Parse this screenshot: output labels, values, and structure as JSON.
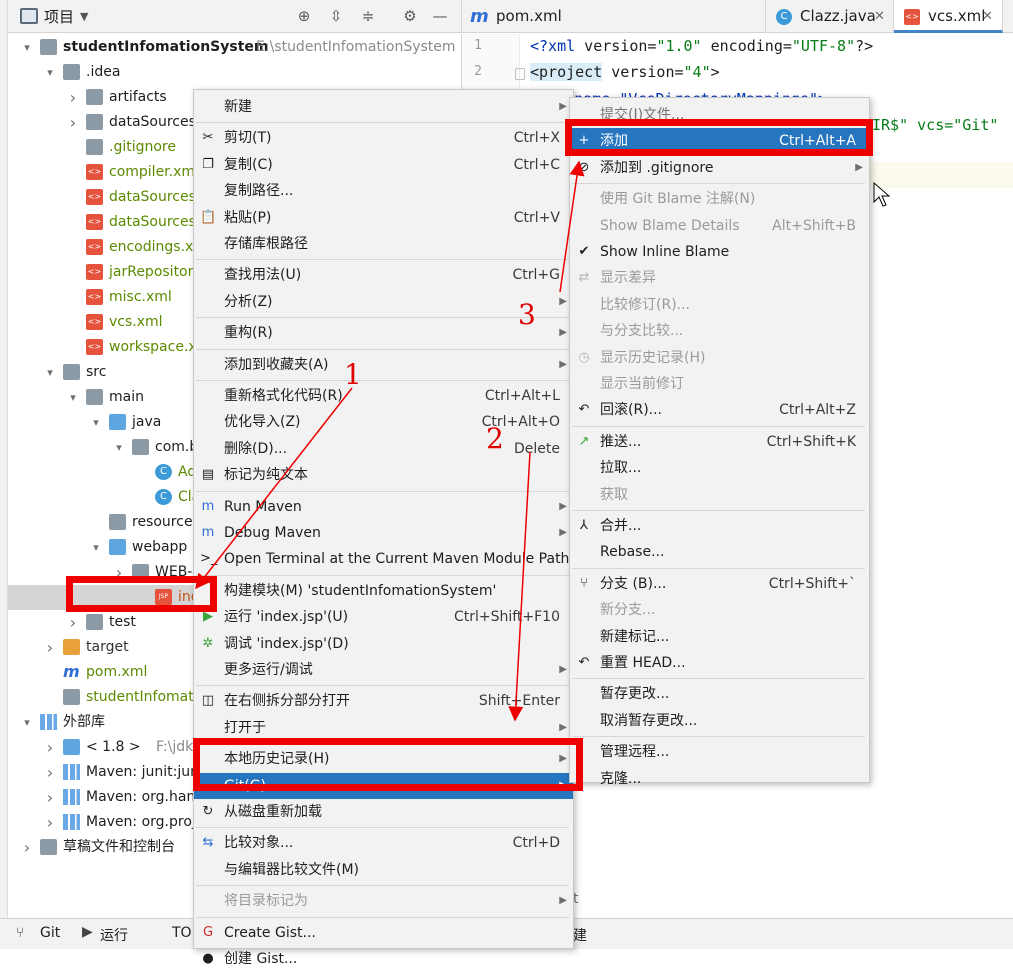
{
  "project_panel": {
    "title": "项目",
    "tree": [
      {
        "depth": 0,
        "name": "studentInfomationSystem",
        "path": "E:\\studentInfomationSystem",
        "icon": "module-icon",
        "expanded": true
      },
      {
        "depth": 1,
        "name": ".idea",
        "icon": "folder-icon",
        "expanded": true
      },
      {
        "depth": 2,
        "name": "artifacts",
        "icon": "folder-icon",
        "expanded": false
      },
      {
        "depth": 2,
        "name": "dataSources",
        "icon": "folder-icon",
        "expanded": false
      },
      {
        "depth": 2,
        "name": ".gitignore",
        "icon": "gitignore-icon",
        "color": "#5b8a00"
      },
      {
        "depth": 2,
        "name": "compiler.xml",
        "icon": "xml-icon",
        "color": "#5b8a00"
      },
      {
        "depth": 2,
        "name": "dataSources.xml",
        "icon": "xml-icon",
        "color": "#5b8a00"
      },
      {
        "depth": 2,
        "name": "dataSources.local.xml",
        "icon": "xml-icon",
        "color": "#5b8a00"
      },
      {
        "depth": 2,
        "name": "encodings.xml",
        "icon": "xml-icon",
        "color": "#5b8a00"
      },
      {
        "depth": 2,
        "name": "jarRepositories.xml",
        "icon": "xml-icon",
        "color": "#5b8a00"
      },
      {
        "depth": 2,
        "name": "misc.xml",
        "icon": "xml-icon",
        "color": "#5b8a00"
      },
      {
        "depth": 2,
        "name": "vcs.xml",
        "icon": "xml-icon",
        "color": "#5b8a00"
      },
      {
        "depth": 2,
        "name": "workspace.xml",
        "icon": "xml-icon",
        "color": "#5b8a00"
      },
      {
        "depth": 1,
        "name": "src",
        "icon": "folder-icon",
        "expanded": true
      },
      {
        "depth": 2,
        "name": "main",
        "icon": "folder-icon",
        "expanded": true
      },
      {
        "depth": 3,
        "name": "java",
        "icon": "source-folder-icon",
        "expanded": true
      },
      {
        "depth": 4,
        "name": "com.b",
        "icon": "package-icon",
        "expanded": true
      },
      {
        "depth": 5,
        "name": "Ad",
        "icon": "class-icon",
        "color": "#5b8a00"
      },
      {
        "depth": 5,
        "name": "Cla",
        "icon": "class-icon",
        "color": "#5b8a00"
      },
      {
        "depth": 3,
        "name": "resources",
        "icon": "resources-folder-icon"
      },
      {
        "depth": 3,
        "name": "webapp",
        "icon": "web-folder-icon",
        "expanded": true
      },
      {
        "depth": 4,
        "name": "WEB-I",
        "icon": "folder-icon",
        "expanded": false
      },
      {
        "depth": 5,
        "name": "index.",
        "icon": "jsp-icon",
        "color": "#c8541a",
        "selected": true
      },
      {
        "depth": 2,
        "name": "test",
        "icon": "folder-icon",
        "expanded": false
      },
      {
        "depth": 1,
        "name": "target",
        "icon": "excluded-folder-icon",
        "expanded": false,
        "color": "#333333"
      },
      {
        "depth": 1,
        "name": "pom.xml",
        "icon": "maven-icon",
        "color": "#5b8a00"
      },
      {
        "depth": 1,
        "name": "studentInfomatio",
        "icon": "iml-icon",
        "color": "#5b8a00"
      },
      {
        "depth": 0,
        "name": "外部库",
        "icon": "library-icon",
        "expanded": true
      },
      {
        "depth": 1,
        "name": "< 1.8 >",
        "path": "F:\\jdk8",
        "icon": "jdk-icon",
        "expanded": false
      },
      {
        "depth": 1,
        "name": "Maven: junit:juni",
        "icon": "library-icon",
        "expanded": false
      },
      {
        "depth": 1,
        "name": "Maven: org.ham",
        "icon": "library-icon",
        "expanded": false
      },
      {
        "depth": 1,
        "name": "Maven: org.proje",
        "icon": "library-icon",
        "expanded": false
      },
      {
        "depth": 0,
        "name": "草稿文件和控制台",
        "icon": "scratch-icon",
        "expanded": false
      }
    ]
  },
  "editor_tabs": [
    {
      "label": "pom.xml (studentInfomationSystem)",
      "icon": "maven-icon",
      "active": false
    },
    {
      "label": "Clazz.java",
      "icon": "class-icon",
      "active": false
    },
    {
      "label": "vcs.xml",
      "icon": "xml-icon",
      "active": true
    }
  ],
  "editor": {
    "line_numbers": [
      "1",
      "2"
    ],
    "lines": [
      "<?xml version=\"1.0\" encoding=\"UTF-8\"?>",
      "<project version=\"4\">",
      "  <component name=\"VcsDirectoryMappings\">",
      "    <mapping directory=\"$PROJECT_DIR$\" vcs=\"Git\" />"
    ],
    "visible_fragments": {
      "l3": "mponent name=\"VcsDirectoryMappings\">",
      "l4": "IR$\" vcs=\"Git\""
    }
  },
  "context_menu": [
    {
      "label": "新建",
      "submenu": true
    },
    {
      "sep": true
    },
    {
      "label": "剪切(T)",
      "shortcut": "Ctrl+X",
      "icon": "cut-icon"
    },
    {
      "label": "复制(C)",
      "shortcut": "Ctrl+C",
      "icon": "copy-icon"
    },
    {
      "label": "复制路径..."
    },
    {
      "label": "粘贴(P)",
      "shortcut": "Ctrl+V",
      "icon": "paste-icon"
    },
    {
      "label": "存储库根路径"
    },
    {
      "sep": true
    },
    {
      "label": "查找用法(U)",
      "shortcut": "Ctrl+G"
    },
    {
      "label": "分析(Z)",
      "submenu": true
    },
    {
      "sep": true
    },
    {
      "label": "重构(R)",
      "submenu": true
    },
    {
      "sep": true
    },
    {
      "label": "添加到收藏夹(A)",
      "submenu": true
    },
    {
      "sep": true
    },
    {
      "label": "重新格式化代码(R)",
      "shortcut": "Ctrl+Alt+L"
    },
    {
      "label": "优化导入(Z)",
      "shortcut": "Ctrl+Alt+O"
    },
    {
      "label": "删除(D)...",
      "shortcut": "Delete"
    },
    {
      "label": "标记为纯文本",
      "icon": "plain-text-icon"
    },
    {
      "sep": true
    },
    {
      "label": "Run Maven",
      "submenu": true,
      "icon": "maven-run-icon"
    },
    {
      "label": "Debug Maven",
      "submenu": true,
      "icon": "maven-debug-icon"
    },
    {
      "label": "Open Terminal at the Current Maven Module Path",
      "icon": "terminal-icon"
    },
    {
      "sep": true
    },
    {
      "label": "构建模块(M) 'studentInfomationSystem'"
    },
    {
      "label": "运行 'index.jsp'(U)",
      "shortcut": "Ctrl+Shift+F10",
      "icon": "run-icon"
    },
    {
      "label": "调试 'index.jsp'(D)",
      "icon": "debug-icon"
    },
    {
      "label": "更多运行/调试",
      "submenu": true
    },
    {
      "sep": true
    },
    {
      "label": "在右侧拆分部分打开",
      "shortcut": "Shift+Enter",
      "icon": "split-icon"
    },
    {
      "label": "打开于",
      "submenu": true
    },
    {
      "sep": true
    },
    {
      "label": "本地历史记录(H)",
      "submenu": true
    },
    {
      "label": "Git(G)",
      "submenu": true,
      "highlighted": true
    },
    {
      "label": "从磁盘重新加载",
      "icon": "reload-icon"
    },
    {
      "sep": true
    },
    {
      "label": "比较对象...",
      "shortcut": "Ctrl+D",
      "icon": "compare-icon"
    },
    {
      "label": "与编辑器比较文件(M)"
    },
    {
      "sep": true
    },
    {
      "label": "将目录标记为",
      "submenu": true,
      "disabled": true
    },
    {
      "sep": true
    },
    {
      "label": "Create Gist...",
      "icon": "gist-icon"
    },
    {
      "label": "创建 Gist...",
      "icon": "github-icon"
    }
  ],
  "git_submenu": [
    {
      "label": "提交(I)文件...",
      "partial": true
    },
    {
      "label": "添加",
      "shortcut": "Ctrl+Alt+A",
      "highlighted": true,
      "icon": "plus-icon"
    },
    {
      "label": "添加到 .gitignore",
      "submenu": true,
      "icon": "gitignore-icon"
    },
    {
      "sep": true
    },
    {
      "label": "使用 Git Blame 注解(N)",
      "disabled": true
    },
    {
      "label": "Show Blame Details",
      "shortcut": "Alt+Shift+B",
      "disabled": true
    },
    {
      "label": "Show Inline Blame",
      "checked": true
    },
    {
      "label": "显示差异",
      "disabled": true,
      "icon": "diff-icon"
    },
    {
      "label": "比较修订(R)...",
      "disabled": true
    },
    {
      "label": "与分支比较...",
      "disabled": true
    },
    {
      "label": "显示历史记录(H)",
      "disabled": true,
      "icon": "history-icon"
    },
    {
      "label": "显示当前修订",
      "disabled": true
    },
    {
      "label": "回滚(R)...",
      "shortcut": "Ctrl+Alt+Z",
      "icon": "rollback-icon"
    },
    {
      "sep": true
    },
    {
      "label": "推送...",
      "shortcut": "Ctrl+Shift+K",
      "icon": "push-icon"
    },
    {
      "label": "拉取..."
    },
    {
      "label": "获取",
      "disabled": true
    },
    {
      "sep": true
    },
    {
      "label": "合并...",
      "icon": "merge-icon"
    },
    {
      "label": "Rebase..."
    },
    {
      "sep": true
    },
    {
      "label": "分支 (B)...",
      "shortcut": "Ctrl+Shift+`",
      "icon": "branch-icon"
    },
    {
      "label": "新分支...",
      "disabled": true
    },
    {
      "label": "新建标记..."
    },
    {
      "label": "重置 HEAD...",
      "icon": "reset-icon"
    },
    {
      "sep": true
    },
    {
      "label": "暂存更改..."
    },
    {
      "label": "取消暂存更改..."
    },
    {
      "sep": true
    },
    {
      "label": "管理远程..."
    },
    {
      "label": "克隆..."
    }
  ],
  "annotations": {
    "n1": "1",
    "n2": "2",
    "n3": "3",
    "color": "#ee0000"
  },
  "bottom_bar": {
    "git": "Git",
    "run": "运行",
    "todo": "TOD",
    "fragment1": "t",
    "fragment2": "建"
  }
}
